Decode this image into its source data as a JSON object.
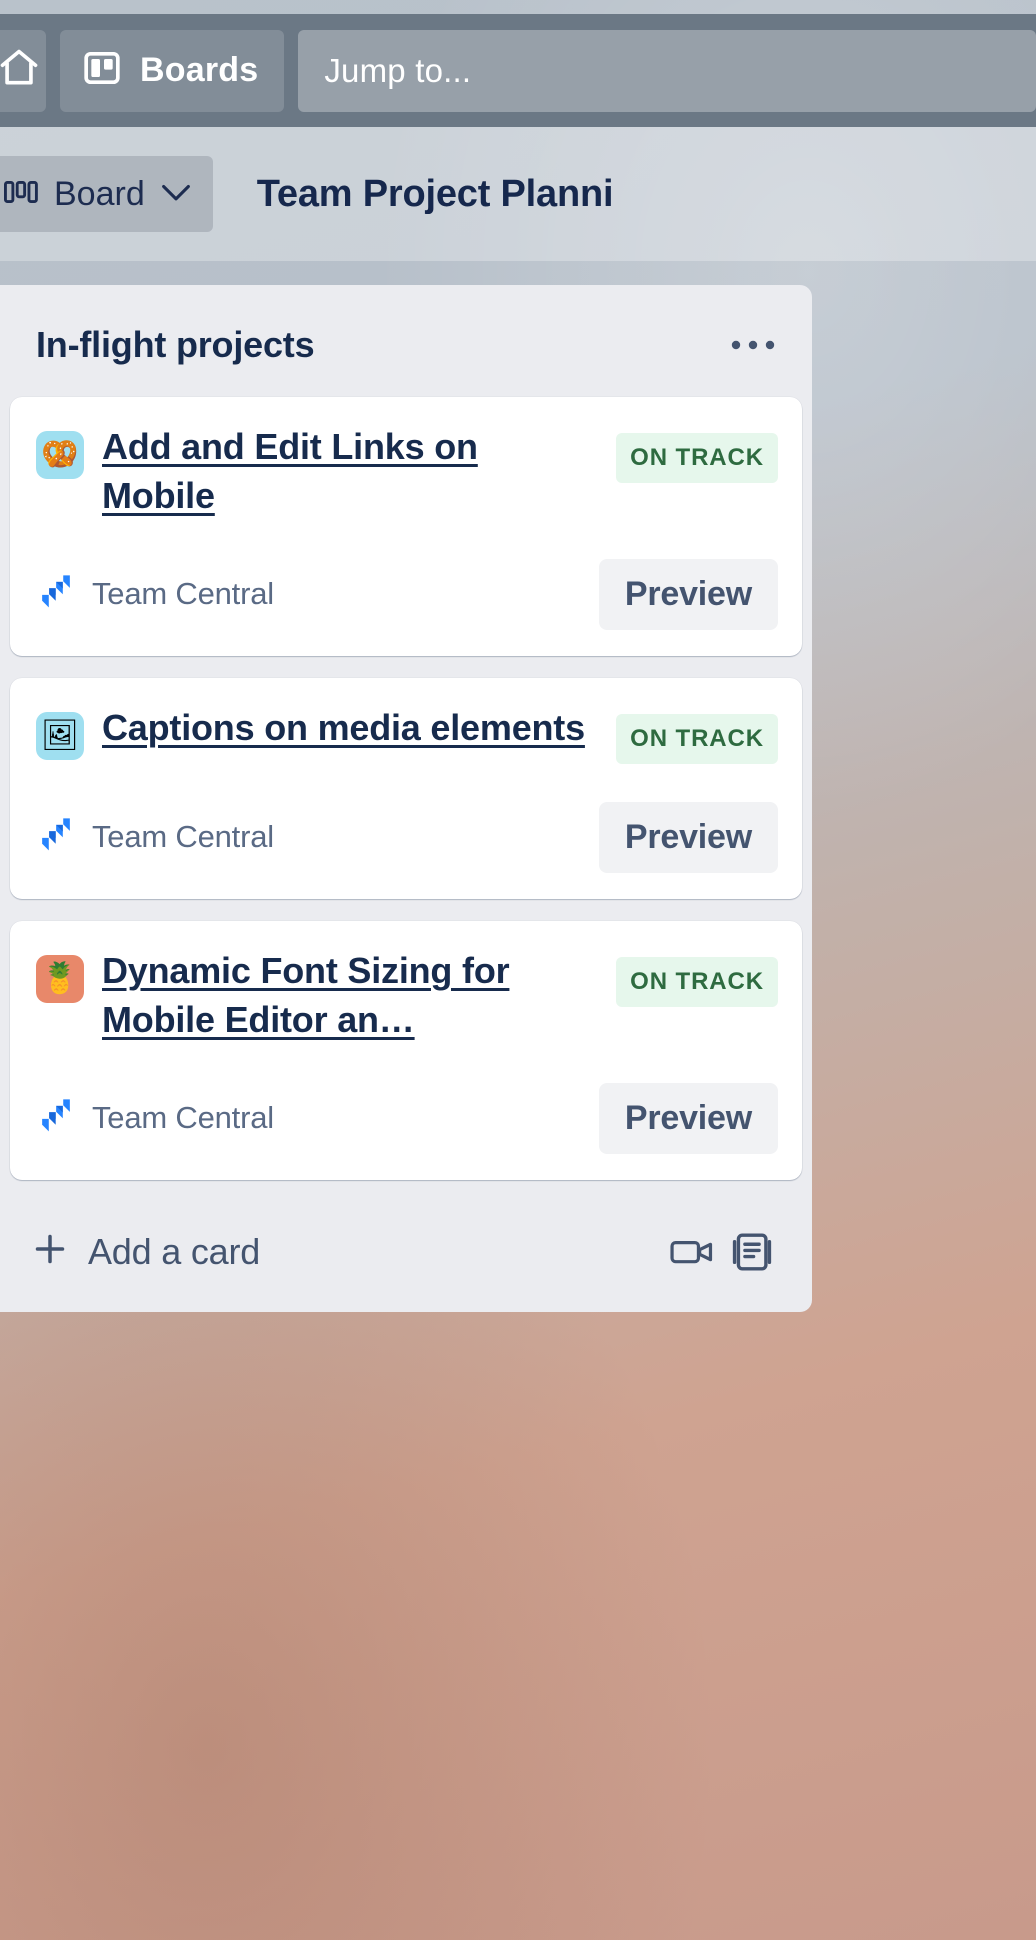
{
  "nav": {
    "home_icon": "home-icon",
    "boards_icon": "board-icon",
    "boards_label": "Boards",
    "jump_to_placeholder": "Jump to..."
  },
  "board_header": {
    "view_icon": "board-view-icon",
    "view_label": "Board",
    "chevron_icon": "chevron-down-icon",
    "title": "Team Project Planni"
  },
  "list": {
    "title": "In-flight projects",
    "menu_icon": "•••",
    "add_card_label": "Add a card",
    "add_card_plus": "+",
    "video_icon": "video-camera-icon",
    "template_icon": "card-template-icon"
  },
  "colors": {
    "nav_background": "#6b7885",
    "list_background": "#ebecf0",
    "card_background": "#ffffff",
    "title_text": "#172b4d",
    "badge_background": "#e6f7ec",
    "badge_text": "#2e6b40",
    "jira_blue": "#2684ff"
  },
  "cards": [
    {
      "emoji": "🥨",
      "emoji_name": "pretzel-emoji",
      "emoji_background": "#9fdff0",
      "title": "Add and Edit Links on Mobile",
      "status": "ON TRACK",
      "source": "Team Central",
      "source_icon": "jira-icon",
      "action_label": "Preview"
    },
    {
      "emoji": "🖼",
      "emoji_name": "framed-picture-emoji",
      "emoji_background": "#9fdff0",
      "title": "Captions on media elements",
      "status": "ON TRACK",
      "source": "Team Central",
      "source_icon": "jira-icon",
      "action_label": "Preview"
    },
    {
      "emoji": "🍍",
      "emoji_name": "pineapple-emoji",
      "emoji_background": "#e8886a",
      "title": "Dynamic Font Sizing for Mobile Editor an…",
      "status": "ON TRACK",
      "source": "Team Central",
      "source_icon": "jira-icon",
      "action_label": "Preview"
    }
  ]
}
